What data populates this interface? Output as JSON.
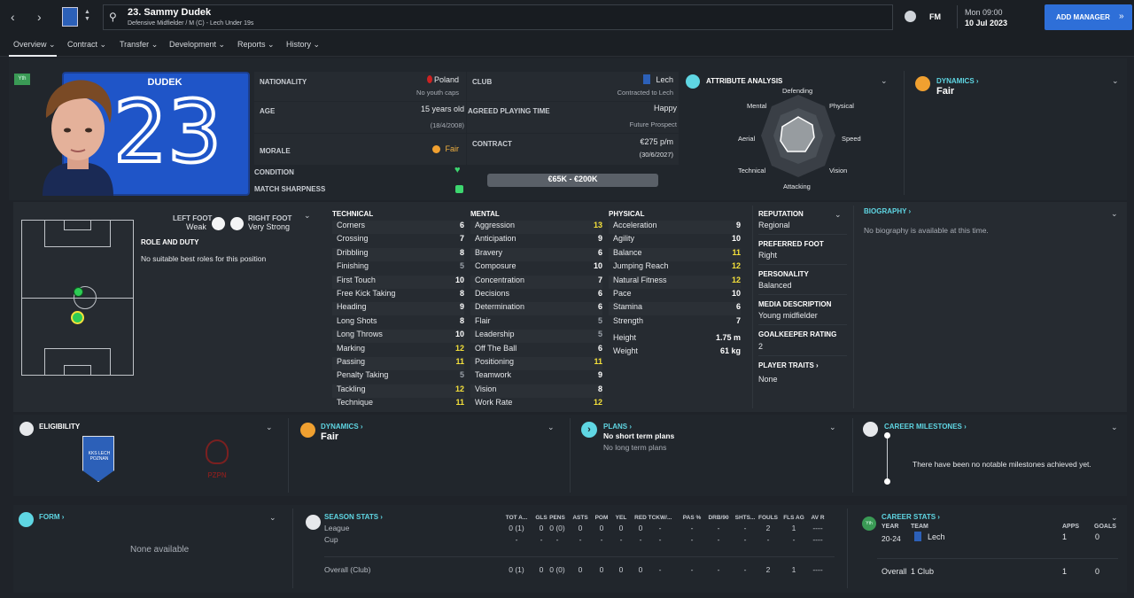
{
  "header": {
    "player_title": "23. Sammy Dudek",
    "player_subtitle": "Defensive Midfielder / M (C) - Lech Under 19s",
    "fm_label": "FM",
    "day_time": "Mon 09:00",
    "date": "10 Jul 2023",
    "add_manager": "ADD MANAGER"
  },
  "tabs": [
    "Overview",
    "Contract",
    "Transfer",
    "Development",
    "Reports",
    "History"
  ],
  "profile": {
    "squad_number": "23",
    "shirt_name": "DUDEK",
    "tag": "Yth",
    "nationality_label": "NATIONALITY",
    "nationality": "Poland",
    "youth_caps": "No youth caps",
    "club_label": "CLUB",
    "club": "Lech",
    "club_contract": "Contracted to Lech",
    "age_label": "AGE",
    "age": "15 years old",
    "dob": "(18/4/2008)",
    "playing_time_label": "AGREED PLAYING TIME",
    "happiness": "Happy",
    "playing_time": "Future Prospect",
    "morale_label": "MORALE",
    "morale": "Fair",
    "contract_label": "CONTRACT",
    "wage": "€275 p/m",
    "contract_end": "(30/6/2027)",
    "condition_label": "CONDITION",
    "sharpness_label": "MATCH SHARPNESS",
    "value": "€65K - €200K"
  },
  "attribute_analysis": {
    "title": "ATTRIBUTE ANALYSIS",
    "labels": [
      "Defending",
      "Physical",
      "Speed",
      "Vision",
      "Attacking",
      "Technical",
      "Aerial",
      "Mental"
    ]
  },
  "dynamics_top": {
    "title": "DYNAMICS",
    "value": "Fair"
  },
  "feet": {
    "left_label": "LEFT FOOT",
    "left_value": "Weak",
    "right_label": "RIGHT FOOT",
    "right_value": "Very Strong"
  },
  "role": {
    "title": "ROLE AND DUTY",
    "text": "No suitable best roles for this position"
  },
  "technical": {
    "title": "TECHNICAL",
    "items": [
      {
        "name": "Corners",
        "value": "6"
      },
      {
        "name": "Crossing",
        "value": "7"
      },
      {
        "name": "Dribbling",
        "value": "8"
      },
      {
        "name": "Finishing",
        "value": "5"
      },
      {
        "name": "First Touch",
        "value": "10"
      },
      {
        "name": "Free Kick Taking",
        "value": "8"
      },
      {
        "name": "Heading",
        "value": "9"
      },
      {
        "name": "Long Shots",
        "value": "8"
      },
      {
        "name": "Long Throws",
        "value": "10"
      },
      {
        "name": "Marking",
        "value": "12"
      },
      {
        "name": "Passing",
        "value": "11"
      },
      {
        "name": "Penalty Taking",
        "value": "5"
      },
      {
        "name": "Tackling",
        "value": "12"
      },
      {
        "name": "Technique",
        "value": "11"
      }
    ]
  },
  "mental": {
    "title": "MENTAL",
    "items": [
      {
        "name": "Aggression",
        "value": "13"
      },
      {
        "name": "Anticipation",
        "value": "9"
      },
      {
        "name": "Bravery",
        "value": "6"
      },
      {
        "name": "Composure",
        "value": "10"
      },
      {
        "name": "Concentration",
        "value": "7"
      },
      {
        "name": "Decisions",
        "value": "6"
      },
      {
        "name": "Determination",
        "value": "6"
      },
      {
        "name": "Flair",
        "value": "5"
      },
      {
        "name": "Leadership",
        "value": "5"
      },
      {
        "name": "Off The Ball",
        "value": "6"
      },
      {
        "name": "Positioning",
        "value": "11"
      },
      {
        "name": "Teamwork",
        "value": "9"
      },
      {
        "name": "Vision",
        "value": "8"
      },
      {
        "name": "Work Rate",
        "value": "12"
      }
    ]
  },
  "physical": {
    "title": "PHYSICAL",
    "items": [
      {
        "name": "Acceleration",
        "value": "9"
      },
      {
        "name": "Agility",
        "value": "10"
      },
      {
        "name": "Balance",
        "value": "11"
      },
      {
        "name": "Jumping Reach",
        "value": "12"
      },
      {
        "name": "Natural Fitness",
        "value": "12"
      },
      {
        "name": "Pace",
        "value": "10"
      },
      {
        "name": "Stamina",
        "value": "6"
      },
      {
        "name": "Strength",
        "value": "7"
      }
    ],
    "height_label": "Height",
    "height": "1.75 m",
    "weight_label": "Weight",
    "weight": "61 kg"
  },
  "info": {
    "reputation_label": "REPUTATION",
    "reputation": "Regional",
    "foot_label": "PREFERRED FOOT",
    "foot": "Right",
    "personality_label": "PERSONALITY",
    "personality": "Balanced",
    "media_label": "MEDIA DESCRIPTION",
    "media": "Young midfielder",
    "gk_label": "GOALKEEPER RATING",
    "gk": "2",
    "traits_label": "PLAYER TRAITS",
    "traits": "None"
  },
  "biography": {
    "title": "BIOGRAPHY",
    "text": "No biography is available at this time."
  },
  "eligibility": {
    "title": "ELIGIBILITY",
    "club_badge_text": "KKS LECH POZNAN",
    "fed_text": "PZPN"
  },
  "dynamics_mid": {
    "title": "DYNAMICS",
    "value": "Fair"
  },
  "plans": {
    "title": "PLANS",
    "short": "No short term plans",
    "long": "No long term plans"
  },
  "milestones": {
    "title": "CAREER MILESTONES",
    "text": "There have been no notable milestones achieved yet."
  },
  "form": {
    "title": "FORM",
    "text": "None available"
  },
  "season_stats": {
    "title": "SEASON STATS",
    "columns": [
      "TOT A...",
      "GLS",
      "PENS",
      "ASTS",
      "POM",
      "YEL",
      "RED",
      "TCKW/...",
      "PAS %",
      "DRB/90",
      "SHTS...",
      "FOULS",
      "FLS AG",
      "AV R"
    ],
    "rows": [
      {
        "label": "League",
        "values": [
          "0 (1)",
          "0",
          "0 (0)",
          "0",
          "0",
          "0",
          "0",
          "-",
          "-",
          "-",
          "-",
          "2",
          "1",
          "----"
        ]
      },
      {
        "label": "Cup",
        "values": [
          "-",
          "-",
          "-",
          "-",
          "-",
          "-",
          "-",
          "-",
          "-",
          "-",
          "-",
          "-",
          "-",
          "----"
        ]
      },
      {
        "label": "Overall (Club)",
        "values": [
          "0 (1)",
          "0",
          "0 (0)",
          "0",
          "0",
          "0",
          "0",
          "-",
          "-",
          "-",
          "-",
          "2",
          "1",
          "----"
        ]
      }
    ]
  },
  "career_stats": {
    "title": "CAREER STATS",
    "year_label": "YEAR",
    "team_label": "TEAM",
    "apps_label": "APPS",
    "goals_label": "GOALS",
    "year": "20-24",
    "team": "Lech",
    "apps": "1",
    "goals": "0",
    "overall_label": "Overall",
    "overall_team": "1 Club",
    "overall_apps": "1",
    "overall_goals": "0",
    "tag": "Yth"
  },
  "colors": {
    "accent": "#2e6fd8",
    "highlight": "#f5e13a",
    "link": "#5fd6e3",
    "status_green": "#3dd66f",
    "morale": "#f0a030"
  }
}
